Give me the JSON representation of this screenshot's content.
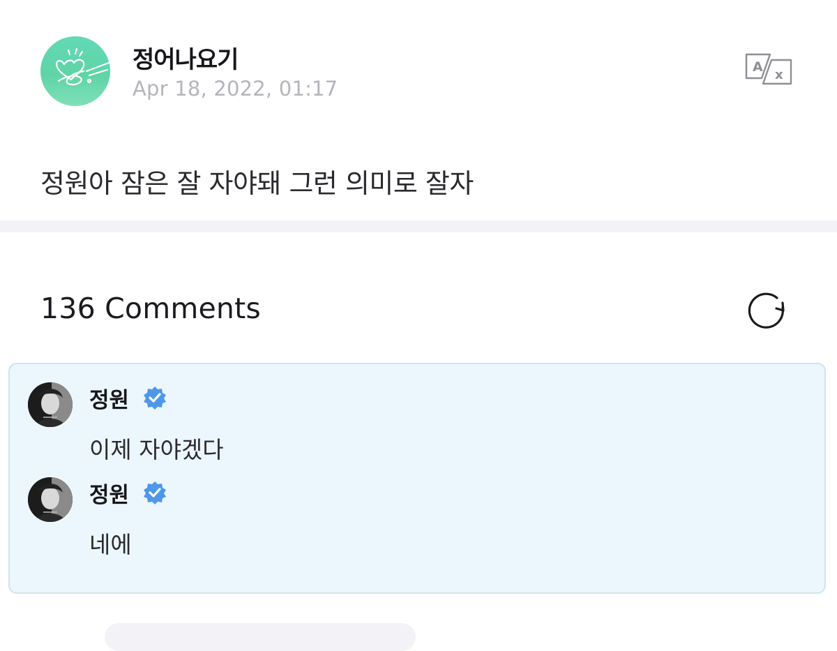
{
  "post": {
    "author_name": "정어나요기",
    "date": "Apr 18, 2022, 01:17",
    "text": "정원아 잠은 잘 자야돼 그런 의미로 잘자",
    "avatar_color": "#5fd4a6"
  },
  "icons": {
    "translate": "translate-icon",
    "refresh": "refresh-icon",
    "verified": "verified-badge-icon"
  },
  "comments_section": {
    "count_label": "136 Comments",
    "highlight_bg": "#ecf7fd",
    "highlight_border": "#cfe4ee",
    "artist_comments": [
      {
        "author": "정원",
        "verified": true,
        "text": "이제 자야겠다"
      },
      {
        "author": "정원",
        "verified": true,
        "text": "네에"
      }
    ]
  },
  "colors": {
    "verified": "#4f97ea",
    "date_text": "#b4b4ba",
    "divider": "#f3f3f7"
  }
}
